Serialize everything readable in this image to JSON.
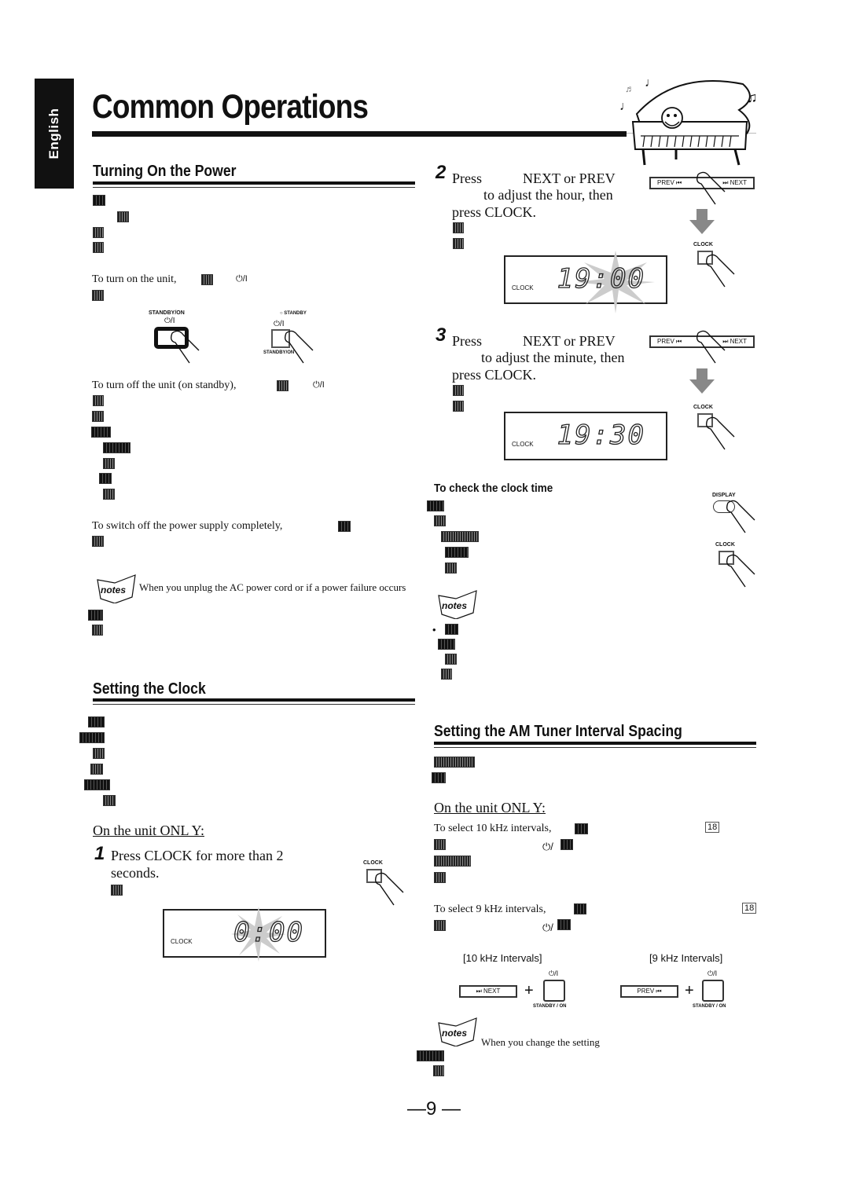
{
  "sidebar": {
    "language_tab": "English"
  },
  "header": {
    "title": "Common Operations"
  },
  "power_section": {
    "heading": "Turning On the Power",
    "turn_on_text": "To turn on the unit,",
    "turn_off_text": "To turn off the unit (on standby),",
    "switch_off_text": "To switch off the power supply completely,",
    "power_symbol": "⏻/I",
    "illustration": {
      "left_button_label": "STANDBY/ON",
      "left_button_symbol": "⏻/I",
      "right_indicator_label": "STANDBY",
      "right_button_symbol": "⏻/I",
      "right_button_label": "STANDBY/ON"
    },
    "note": {
      "icon_label": "notes",
      "text": "When you unplug the AC power cord or if a power failure occurs"
    }
  },
  "clock_section": {
    "heading": "Setting the Clock",
    "unit_only_label": "On the unit ONL  Y:",
    "steps": [
      {
        "number": "1",
        "text": "Press CLOCK for more than 2 seconds.",
        "button_label": "CLOCK",
        "display_label": "CLOCK",
        "display_value": "0:00"
      },
      {
        "number": "2",
        "text_line1": "Press",
        "text_keys": "NEXT or PREV",
        "text_line2": "to adjust the hour, then",
        "text_line3": "press CLOCK.",
        "remote_prev": "PREV ⏮",
        "remote_next": "⏭ NEXT",
        "button_label": "CLOCK",
        "display_label": "CLOCK",
        "display_value": "19:00"
      },
      {
        "number": "3",
        "text_line1": "Press",
        "text_keys": "NEXT or PREV",
        "text_line2": "to adjust the minute, then",
        "text_line3": "press CLOCK.",
        "remote_prev": "PREV ⏮",
        "remote_next": "⏭ NEXT",
        "button_label": "CLOCK",
        "display_label": "CLOCK",
        "display_value": "19:30"
      }
    ],
    "check_time": {
      "heading": "To check the clock time",
      "display_button_label": "DISPLAY",
      "clock_button_label": "CLOCK",
      "note_icon_label": "notes",
      "bullet": "•"
    }
  },
  "am_section": {
    "heading": "Setting the AM Tuner Interval Spacing",
    "unit_only_label": "On the unit ONL  Y:",
    "select_10": "To select 10 kHz intervals,",
    "select_9": "To select 9 kHz intervals,",
    "page_ref": "18",
    "power_symbol": "⏻/",
    "diagram": {
      "label_10": "[10 kHz Intervals]",
      "label_9": "[9 kHz Intervals]",
      "next_button": "⏭ NEXT",
      "prev_button": "PREV ⏮",
      "plus": "+",
      "standby_symbol": "⏻/I",
      "standby_label": "STANDBY / ON"
    },
    "note": {
      "icon_label": "notes",
      "text": "When you change the setting"
    }
  },
  "footer": {
    "page_number": "—9 —"
  }
}
